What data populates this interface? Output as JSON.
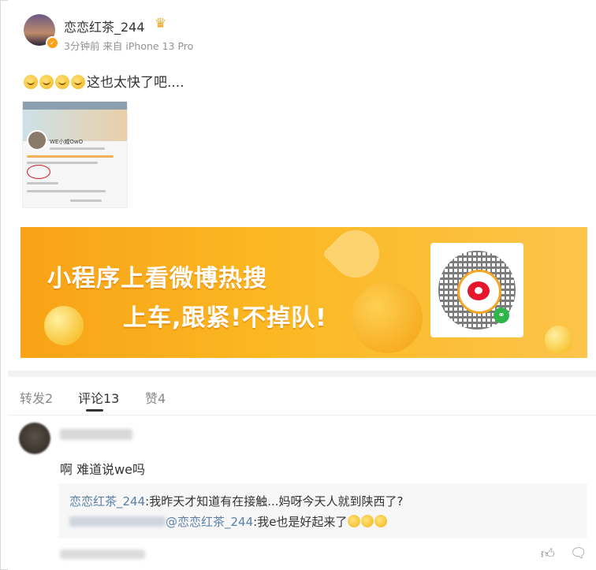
{
  "post": {
    "username": "恋恋红茶_244",
    "meta": "3分钟前 来自 iPhone 13 Pro",
    "text": "这也太快了吧....",
    "emoji_count": 4
  },
  "thumbnail": {
    "profile_name": "WE小威OwO"
  },
  "banner": {
    "line1": "小程序上看微博热搜",
    "line2": "上车,跟紧!不掉队!"
  },
  "tabs": [
    {
      "label": "转发2"
    },
    {
      "label": "评论13"
    },
    {
      "label": "赞4"
    }
  ],
  "comment": {
    "text": "啊 难道说we吗",
    "reply1_user": "恋恋红茶_244",
    "reply1_text": ":我昨天才知道有在接触...妈呀今天人就到陕西了?",
    "reply2_mention": "@恋恋红茶_244",
    "reply2_text": ":我e也是好起来了"
  }
}
